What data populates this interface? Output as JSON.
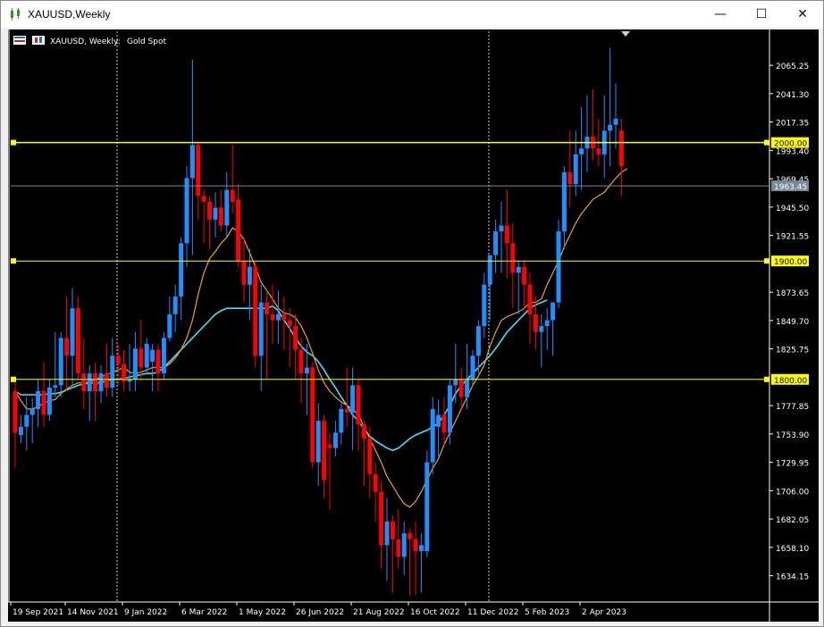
{
  "window": {
    "title": "XAUUSD,Weekly",
    "buttons": {
      "minimize": "—",
      "maximize": "☐",
      "close": "✕"
    }
  },
  "chart_header": {
    "symbol_line": "XAUUSD, Weekly:",
    "description": "Gold Spot"
  },
  "colors": {
    "background": "#000000",
    "bull": "#1e90ff",
    "bear": "#ff0000",
    "ma_fast": "#f0a030",
    "ma_slow": "#40e0ff",
    "level_line": "#ffff00",
    "current_line": "#778899"
  },
  "chart_data": {
    "type": "candlestick",
    "timeframe": "Weekly",
    "ylim": [
      1612,
      2094
    ],
    "y_ticks": [
      "2065.25",
      "2041.30",
      "2017.35",
      "1993.40",
      "1969.45",
      "1945.50",
      "1921.55",
      "1873.65",
      "1849.70",
      "1825.75",
      "1777.85",
      "1753.90",
      "1729.95",
      "1706.00",
      "1682.05",
      "1658.10",
      "1634.15"
    ],
    "x_labels": [
      "19 Sep 2021",
      "14 Nov 2021",
      "9 Jan 2022",
      "6 Mar 2022",
      "1 May 2022",
      "26 Jun 2022",
      "21 Aug 2022",
      "16 Oct 2022",
      "11 Dec 2022",
      "5 Feb 2023",
      "2 Apr 2023"
    ],
    "horizontal_levels": [
      {
        "label": "2000.00",
        "value": 2000.0
      },
      {
        "label": "1900.00",
        "value": 1900.0
      },
      {
        "label": "1800.00",
        "value": 1800.0
      }
    ],
    "current_price": {
      "label": "1963.45",
      "value": 1963.45
    },
    "candles": [
      {
        "o": 1790,
        "h": 1800,
        "l": 1725,
        "c": 1755
      },
      {
        "o": 1753,
        "h": 1770,
        "l": 1746,
        "c": 1760
      },
      {
        "o": 1760,
        "h": 1785,
        "l": 1740,
        "c": 1770
      },
      {
        "o": 1770,
        "h": 1784,
        "l": 1746,
        "c": 1775
      },
      {
        "o": 1775,
        "h": 1800,
        "l": 1760,
        "c": 1790
      },
      {
        "o": 1790,
        "h": 1815,
        "l": 1760,
        "c": 1770
      },
      {
        "o": 1770,
        "h": 1800,
        "l": 1765,
        "c": 1793
      },
      {
        "o": 1793,
        "h": 1840,
        "l": 1785,
        "c": 1795
      },
      {
        "o": 1795,
        "h": 1840,
        "l": 1785,
        "c": 1835
      },
      {
        "o": 1835,
        "h": 1870,
        "l": 1790,
        "c": 1820
      },
      {
        "o": 1820,
        "h": 1877,
        "l": 1795,
        "c": 1860
      },
      {
        "o": 1860,
        "h": 1870,
        "l": 1800,
        "c": 1805
      },
      {
        "o": 1805,
        "h": 1835,
        "l": 1775,
        "c": 1790
      },
      {
        "o": 1790,
        "h": 1812,
        "l": 1765,
        "c": 1805
      },
      {
        "o": 1805,
        "h": 1814,
        "l": 1765,
        "c": 1790
      },
      {
        "o": 1790,
        "h": 1812,
        "l": 1780,
        "c": 1805
      },
      {
        "o": 1805,
        "h": 1830,
        "l": 1785,
        "c": 1793
      },
      {
        "o": 1793,
        "h": 1835,
        "l": 1785,
        "c": 1820
      },
      {
        "o": 1820,
        "h": 1830,
        "l": 1795,
        "c": 1813
      },
      {
        "o": 1813,
        "h": 1825,
        "l": 1790,
        "c": 1798
      },
      {
        "o": 1798,
        "h": 1830,
        "l": 1790,
        "c": 1800
      },
      {
        "o": 1800,
        "h": 1840,
        "l": 1790,
        "c": 1826
      },
      {
        "o": 1826,
        "h": 1850,
        "l": 1800,
        "c": 1810
      },
      {
        "o": 1810,
        "h": 1835,
        "l": 1805,
        "c": 1830
      },
      {
        "o": 1815,
        "h": 1830,
        "l": 1790,
        "c": 1825
      },
      {
        "o": 1825,
        "h": 1830,
        "l": 1790,
        "c": 1805
      },
      {
        "o": 1805,
        "h": 1840,
        "l": 1800,
        "c": 1835
      },
      {
        "o": 1835,
        "h": 1870,
        "l": 1832,
        "c": 1855
      },
      {
        "o": 1855,
        "h": 1880,
        "l": 1840,
        "c": 1870
      },
      {
        "o": 1870,
        "h": 1920,
        "l": 1850,
        "c": 1915
      },
      {
        "o": 1915,
        "h": 1980,
        "l": 1895,
        "c": 1970
      },
      {
        "o": 1970,
        "h": 2070,
        "l": 1905,
        "c": 1998
      },
      {
        "o": 1998,
        "h": 2000,
        "l": 1935,
        "c": 1955
      },
      {
        "o": 1955,
        "h": 1960,
        "l": 1915,
        "c": 1950
      },
      {
        "o": 1950,
        "h": 1955,
        "l": 1910,
        "c": 1935
      },
      {
        "o": 1935,
        "h": 1958,
        "l": 1920,
        "c": 1945
      },
      {
        "o": 1945,
        "h": 1960,
        "l": 1925,
        "c": 1930
      },
      {
        "o": 1930,
        "h": 1975,
        "l": 1920,
        "c": 1960
      },
      {
        "o": 1960,
        "h": 1998,
        "l": 1940,
        "c": 1950
      },
      {
        "o": 1952,
        "h": 1965,
        "l": 1895,
        "c": 1900
      },
      {
        "o": 1900,
        "h": 1920,
        "l": 1865,
        "c": 1880
      },
      {
        "o": 1880,
        "h": 1910,
        "l": 1850,
        "c": 1895
      },
      {
        "o": 1895,
        "h": 1900,
        "l": 1810,
        "c": 1820
      },
      {
        "o": 1820,
        "h": 1880,
        "l": 1790,
        "c": 1865
      },
      {
        "o": 1865,
        "h": 1875,
        "l": 1800,
        "c": 1855
      },
      {
        "o": 1855,
        "h": 1880,
        "l": 1830,
        "c": 1850
      },
      {
        "o": 1850,
        "h": 1875,
        "l": 1830,
        "c": 1855
      },
      {
        "o": 1855,
        "h": 1870,
        "l": 1825,
        "c": 1850
      },
      {
        "o": 1850,
        "h": 1860,
        "l": 1810,
        "c": 1845
      },
      {
        "o": 1845,
        "h": 1855,
        "l": 1800,
        "c": 1825
      },
      {
        "o": 1825,
        "h": 1835,
        "l": 1780,
        "c": 1805
      },
      {
        "o": 1805,
        "h": 1830,
        "l": 1770,
        "c": 1810
      },
      {
        "o": 1810,
        "h": 1815,
        "l": 1725,
        "c": 1730
      },
      {
        "o": 1730,
        "h": 1780,
        "l": 1710,
        "c": 1765
      },
      {
        "o": 1765,
        "h": 1770,
        "l": 1700,
        "c": 1715
      },
      {
        "o": 1745,
        "h": 1755,
        "l": 1690,
        "c": 1742
      },
      {
        "o": 1742,
        "h": 1765,
        "l": 1735,
        "c": 1755
      },
      {
        "o": 1755,
        "h": 1780,
        "l": 1745,
        "c": 1775
      },
      {
        "o": 1775,
        "h": 1810,
        "l": 1760,
        "c": 1772
      },
      {
        "o": 1772,
        "h": 1810,
        "l": 1740,
        "c": 1795
      },
      {
        "o": 1795,
        "h": 1800,
        "l": 1740,
        "c": 1762
      },
      {
        "o": 1762,
        "h": 1765,
        "l": 1710,
        "c": 1750
      },
      {
        "o": 1750,
        "h": 1760,
        "l": 1700,
        "c": 1720
      },
      {
        "o": 1720,
        "h": 1730,
        "l": 1680,
        "c": 1705
      },
      {
        "o": 1705,
        "h": 1715,
        "l": 1640,
        "c": 1660
      },
      {
        "o": 1660,
        "h": 1700,
        "l": 1630,
        "c": 1680
      },
      {
        "o": 1680,
        "h": 1685,
        "l": 1620,
        "c": 1665
      },
      {
        "o": 1665,
        "h": 1690,
        "l": 1640,
        "c": 1650
      },
      {
        "o": 1650,
        "h": 1680,
        "l": 1635,
        "c": 1670
      },
      {
        "o": 1670,
        "h": 1675,
        "l": 1617,
        "c": 1665
      },
      {
        "o": 1665,
        "h": 1680,
        "l": 1618,
        "c": 1655
      },
      {
        "o": 1655,
        "h": 1670,
        "l": 1620,
        "c": 1660
      },
      {
        "o": 1655,
        "h": 1740,
        "l": 1650,
        "c": 1730
      },
      {
        "o": 1730,
        "h": 1785,
        "l": 1720,
        "c": 1775
      },
      {
        "o": 1760,
        "h": 1783,
        "l": 1735,
        "c": 1770
      },
      {
        "o": 1770,
        "h": 1785,
        "l": 1745,
        "c": 1755
      },
      {
        "o": 1755,
        "h": 1800,
        "l": 1745,
        "c": 1795
      },
      {
        "o": 1795,
        "h": 1830,
        "l": 1780,
        "c": 1800
      },
      {
        "o": 1800,
        "h": 1810,
        "l": 1775,
        "c": 1785
      },
      {
        "o": 1785,
        "h": 1830,
        "l": 1775,
        "c": 1800
      },
      {
        "o": 1800,
        "h": 1825,
        "l": 1795,
        "c": 1820
      },
      {
        "o": 1820,
        "h": 1850,
        "l": 1805,
        "c": 1845
      },
      {
        "o": 1845,
        "h": 1890,
        "l": 1835,
        "c": 1880
      },
      {
        "o": 1880,
        "h": 1900,
        "l": 1850,
        "c": 1905
      },
      {
        "o": 1905,
        "h": 1935,
        "l": 1890,
        "c": 1925
      },
      {
        "o": 1925,
        "h": 1950,
        "l": 1890,
        "c": 1930
      },
      {
        "o": 1930,
        "h": 1960,
        "l": 1885,
        "c": 1915
      },
      {
        "o": 1915,
        "h": 1932,
        "l": 1860,
        "c": 1890
      },
      {
        "o": 1890,
        "h": 1900,
        "l": 1855,
        "c": 1895
      },
      {
        "o": 1895,
        "h": 1900,
        "l": 1860,
        "c": 1880
      },
      {
        "o": 1880,
        "h": 1890,
        "l": 1830,
        "c": 1855
      },
      {
        "o": 1855,
        "h": 1870,
        "l": 1825,
        "c": 1840
      },
      {
        "o": 1840,
        "h": 1855,
        "l": 1810,
        "c": 1845
      },
      {
        "o": 1845,
        "h": 1860,
        "l": 1825,
        "c": 1850
      },
      {
        "o": 1850,
        "h": 1860,
        "l": 1820,
        "c": 1865
      },
      {
        "o": 1865,
        "h": 1935,
        "l": 1860,
        "c": 1925
      },
      {
        "o": 1925,
        "h": 1980,
        "l": 1910,
        "c": 1975
      },
      {
        "o": 1975,
        "h": 2010,
        "l": 1945,
        "c": 1965
      },
      {
        "o": 1965,
        "h": 2010,
        "l": 1955,
        "c": 1990
      },
      {
        "o": 1990,
        "h": 2030,
        "l": 1960,
        "c": 1995
      },
      {
        "o": 1995,
        "h": 2040,
        "l": 1975,
        "c": 2005
      },
      {
        "o": 2005,
        "h": 2045,
        "l": 1985,
        "c": 1995
      },
      {
        "o": 1995,
        "h": 2020,
        "l": 1980,
        "c": 1990
      },
      {
        "o": 1990,
        "h": 2040,
        "l": 1970,
        "c": 2010
      },
      {
        "o": 2010,
        "h": 2080,
        "l": 1980,
        "c": 2015
      },
      {
        "o": 2015,
        "h": 2050,
        "l": 1995,
        "c": 2020
      },
      {
        "o": 2010,
        "h": 2020,
        "l": 1955,
        "c": 1980
      }
    ],
    "ma_fast": [
      1790,
      1782,
      1775,
      1775,
      1777,
      1780,
      1782,
      1783,
      1788,
      1792,
      1795,
      1797,
      1797,
      1798,
      1800,
      1802,
      1804,
      1806,
      1808,
      1810,
      1806,
      1805,
      1806,
      1808,
      1810,
      1810,
      1810,
      1813,
      1818,
      1825,
      1835,
      1850,
      1872,
      1890,
      1902,
      1908,
      1915,
      1920,
      1928,
      1925,
      1918,
      1907,
      1895,
      1882,
      1875,
      1868,
      1860,
      1856,
      1855,
      1852,
      1845,
      1835,
      1822,
      1808,
      1797,
      1790,
      1785,
      1781,
      1778,
      1775,
      1770,
      1760,
      1750,
      1740,
      1730,
      1718,
      1710,
      1702,
      1695,
      1692,
      1697,
      1705,
      1715,
      1725,
      1733,
      1745,
      1755,
      1765,
      1775,
      1785,
      1795,
      1803,
      1812,
      1828,
      1840,
      1850,
      1853,
      1855,
      1857,
      1860,
      1865,
      1865,
      1868,
      1880,
      1890,
      1900,
      1912,
      1922,
      1932,
      1940,
      1946,
      1952,
      1955,
      1958,
      1964,
      1970,
      1975,
      1978
    ],
    "ma_slow": [
      1790,
      1787,
      1787,
      1787,
      1787,
      1787,
      1788,
      1788,
      1789,
      1791,
      1793,
      1795,
      1796,
      1797,
      1797,
      1797,
      1799,
      1800,
      1800,
      1801,
      1802,
      1803,
      1804,
      1805,
      1805,
      1806,
      1810,
      1815,
      1820,
      1825,
      1830,
      1835,
      1840,
      1845,
      1850,
      1855,
      1858,
      1860,
      1860,
      1860,
      1860,
      1860,
      1860,
      1860,
      1860,
      1862,
      1858,
      1850,
      1843,
      1835,
      1828,
      1823,
      1820,
      1815,
      1808,
      1800,
      1793,
      1785,
      1778,
      1770,
      1765,
      1758,
      1752,
      1748,
      1745,
      1742,
      1740,
      1742,
      1746,
      1750,
      1753,
      1755,
      1757,
      1760,
      1763,
      1770,
      1778,
      1788,
      1795,
      1800,
      1805,
      1810,
      1815,
      1820,
      1826,
      1833,
      1840,
      1845,
      1850,
      1855,
      1860,
      1863,
      1865,
      1867
    ]
  }
}
